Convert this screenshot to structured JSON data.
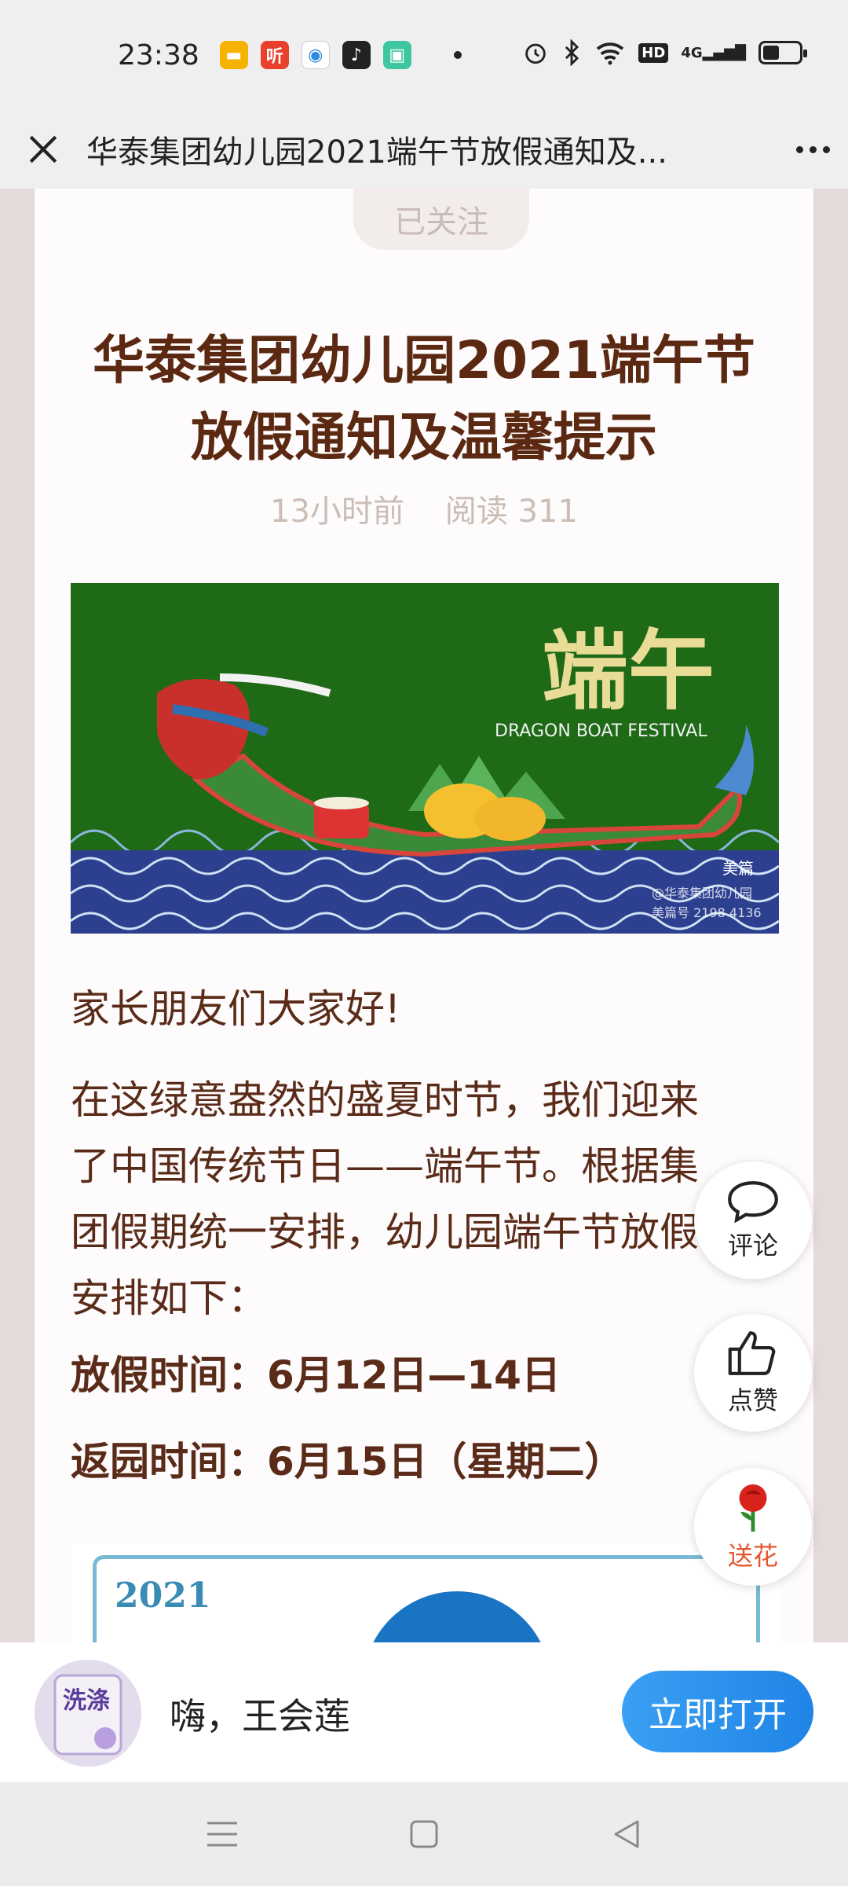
{
  "status_bar": {
    "time": "23:38",
    "app_icons": [
      {
        "name": "notes-app-icon",
        "color": "#f5b300",
        "glyph": "▬"
      },
      {
        "name": "listen-app-icon",
        "color": "#e8402a",
        "glyph": "听"
      },
      {
        "name": "browser-app-icon",
        "color": "#2f8be0",
        "glyph": "◉"
      },
      {
        "name": "tiktok-app-icon",
        "color": "#222222",
        "glyph": "♪"
      },
      {
        "name": "store-app-icon",
        "color": "#3ec6a0",
        "glyph": "▣"
      }
    ],
    "network_label": "4G"
  },
  "nav": {
    "title": "华泰集团幼儿园2021端午节放假通知及..."
  },
  "article": {
    "follow_label": "已关注",
    "title_line1": "华泰集团幼儿园2021端午节",
    "title_line2": "放假通知及温馨提示",
    "time_ago": "13小时前",
    "read_count": "阅读 311",
    "banner": {
      "title_chars": "端午",
      "subtitle": "DRAGON BOAT FESTIVAL",
      "brand": "美篇",
      "watermark_line1": "@华泰集团幼儿园",
      "watermark_line2": "美篇号 2198 4136"
    },
    "greeting": "家长朋友们大家好!",
    "body_line1": "在这绿意盎然的盛夏时节，我们迎来",
    "body_line2": "了中国传统节日——端午节。根据集",
    "body_line3": "团假期统一安排，幼儿园端午节放假",
    "body_line4": "安排如下：",
    "holiday_time": "放假时间：6月12日—14日",
    "return_time": "返园时间：6月15日（星期二）",
    "second_image_year": "2021"
  },
  "fabs": {
    "comment_label": "评论",
    "like_label": "点赞",
    "flower_label": "送花"
  },
  "open_bar": {
    "greeting": "嗨，王会莲",
    "open_button": "立即打开",
    "avatar_text": "洗涤"
  },
  "colors": {
    "title_brown": "#5b2812",
    "banner_green": "#1e6a17",
    "open_blue": "#1f84e6"
  }
}
